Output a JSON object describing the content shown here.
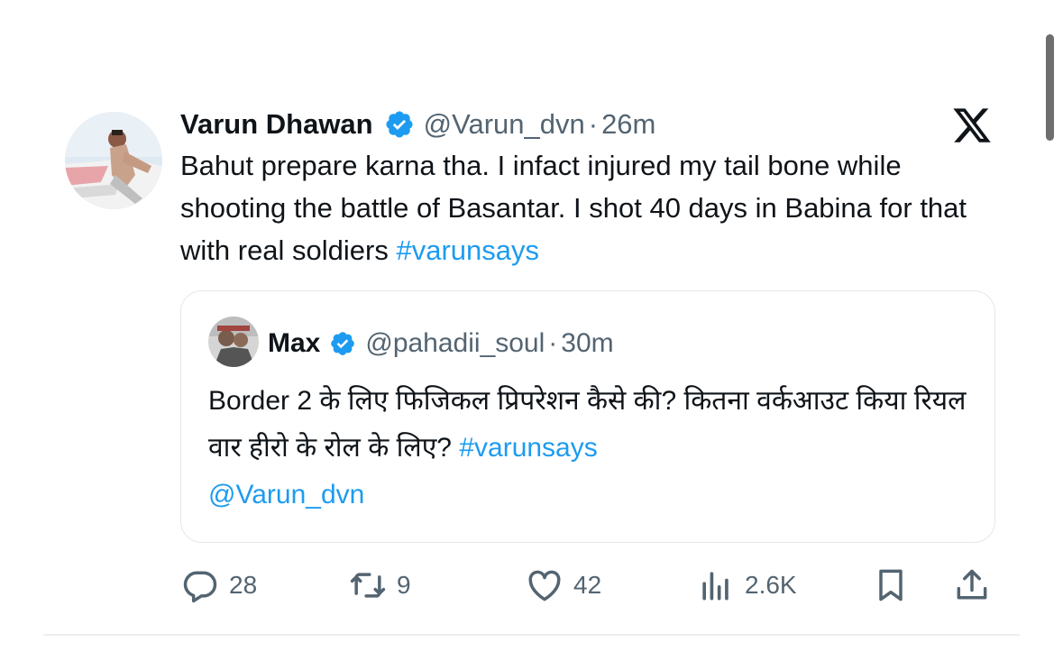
{
  "tweet": {
    "display_name": "Varun Dhawan",
    "handle": "@Varun_dvn",
    "separator": "·",
    "time": "26m",
    "text_before_hashtag": "Bahut prepare karna tha. I infact injured my tail bone while shooting the battle of Basantar. I shot 40 days in Babina for that with real soldiers ",
    "hashtag": "#varunsays",
    "verified_icon": "verified-badge-icon",
    "platform_logo": "x-logo-icon"
  },
  "quoted_tweet": {
    "display_name": "Max",
    "handle": "@pahadii_soul",
    "separator": "·",
    "time": "30m",
    "text_before_hashtag": "Border 2 के लिए फिजिकल प्रिपरेशन कैसे की? कितना वर्कआउट किया रियल वार हीरो के रोल के लिए? ",
    "hashtag": "#varunsays",
    "mention": "@Varun_dvn"
  },
  "actions": {
    "replies": "28",
    "reposts": "9",
    "likes": "42",
    "views": "2.6K",
    "icons": [
      "reply-icon",
      "repost-icon",
      "like-icon",
      "views-icon",
      "bookmark-icon",
      "share-icon"
    ]
  },
  "colors": {
    "text": "#0f1419",
    "secondary": "#536471",
    "link": "#1d9bf0",
    "verified": "#1d9bf0",
    "border": "#e3e7ea"
  }
}
